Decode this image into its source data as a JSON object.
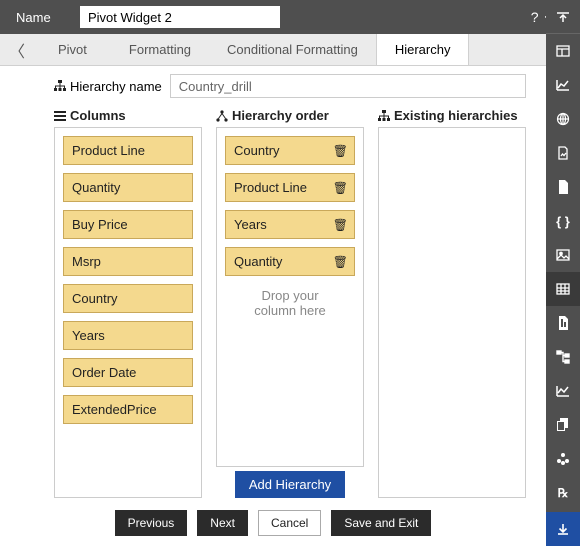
{
  "header": {
    "name_label": "Name",
    "name_value": "Pivot Widget 2"
  },
  "tabs": {
    "items": [
      "Pivot",
      "Formatting",
      "Conditional Formatting",
      "Hierarchy"
    ],
    "active_index": 3
  },
  "hierarchy_name": {
    "label": "Hierarchy name",
    "value": "Country_drill"
  },
  "columns_panel": {
    "title": "Columns",
    "items": [
      "Product Line",
      "Quantity",
      "Buy Price",
      "Msrp",
      "Country",
      "Years",
      "Order Date",
      "ExtendedPrice"
    ]
  },
  "order_panel": {
    "title": "Hierarchy order",
    "items": [
      "Country",
      "Product Line",
      "Years",
      "Quantity"
    ],
    "drop_hint_line1": "Drop your",
    "drop_hint_line2": "column here",
    "add_button": "Add Hierarchy"
  },
  "existing_panel": {
    "title": "Existing hierarchies"
  },
  "footer": {
    "previous": "Previous",
    "next": "Next",
    "cancel": "Cancel",
    "save": "Save and Exit"
  }
}
